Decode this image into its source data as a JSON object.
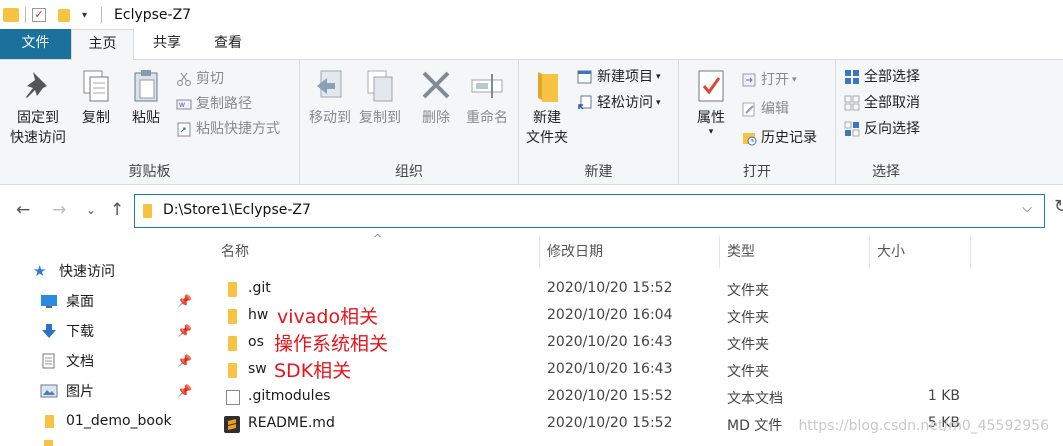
{
  "window": {
    "title": "Eclypse-Z7"
  },
  "tabs": [
    "文件",
    "主页",
    "共享",
    "查看"
  ],
  "ribbon": {
    "clipboard": {
      "pin_label_1": "固定到",
      "pin_label_2": "快速访问",
      "copy": "复制",
      "paste": "粘贴",
      "cut": "剪切",
      "copy_path": "复制路径",
      "paste_shortcut": "粘贴快捷方式",
      "group": "剪贴板"
    },
    "organize": {
      "move_to": "移动到",
      "copy_to": "复制到",
      "delete": "删除",
      "rename": "重命名",
      "group": "组织"
    },
    "new": {
      "new_folder_1": "新建",
      "new_folder_2": "文件夹",
      "new_item": "新建项目",
      "easy_access": "轻松访问",
      "group": "新建"
    },
    "open": {
      "properties": "属性",
      "open": "打开",
      "edit": "编辑",
      "history": "历史记录",
      "group": "打开"
    },
    "select": {
      "select_all": "全部选择",
      "select_none": "全部取消",
      "invert": "反向选择",
      "group": "选择"
    }
  },
  "address": {
    "path": "D:\\Store1\\Eclypse-Z7"
  },
  "sidebar": {
    "items": [
      {
        "label": "快速访问",
        "icon": "star-icon"
      },
      {
        "label": "桌面",
        "icon": "desktop-icon",
        "pinned": true
      },
      {
        "label": "下载",
        "icon": "download-icon",
        "pinned": true
      },
      {
        "label": "文档",
        "icon": "document-icon",
        "pinned": true
      },
      {
        "label": "图片",
        "icon": "pictures-icon",
        "pinned": true
      },
      {
        "label": "01_demo_book",
        "icon": "folder-icon"
      }
    ]
  },
  "columns": [
    "名称",
    "修改日期",
    "类型",
    "大小"
  ],
  "files": [
    {
      "name": ".git",
      "date": "2020/10/20 15:52",
      "type": "文件夹",
      "size": "",
      "note": "",
      "icon": "folder-icon"
    },
    {
      "name": "hw",
      "date": "2020/10/20 16:04",
      "type": "文件夹",
      "size": "",
      "note": "vivado相关",
      "icon": "folder-icon"
    },
    {
      "name": "os",
      "date": "2020/10/20 16:43",
      "type": "文件夹",
      "size": "",
      "note": "操作系统相关",
      "icon": "folder-icon"
    },
    {
      "name": "sw",
      "date": "2020/10/20 16:43",
      "type": "文件夹",
      "size": "",
      "note": "SDK相关",
      "icon": "folder-icon"
    },
    {
      "name": ".gitmodules",
      "date": "2020/10/20 15:52",
      "type": "文本文档",
      "size": "1 KB",
      "note": "",
      "icon": "text-file-icon"
    },
    {
      "name": "README.md",
      "date": "2020/10/20 15:52",
      "type": "MD 文件",
      "size": "5 KB",
      "note": "",
      "icon": "sublime-file-icon"
    }
  ],
  "watermark": "https://blog.csdn.net/m0_45592956",
  "colors": {
    "accent": "#19719c",
    "annotation": "#e8141b",
    "folder": "#f6c343"
  }
}
